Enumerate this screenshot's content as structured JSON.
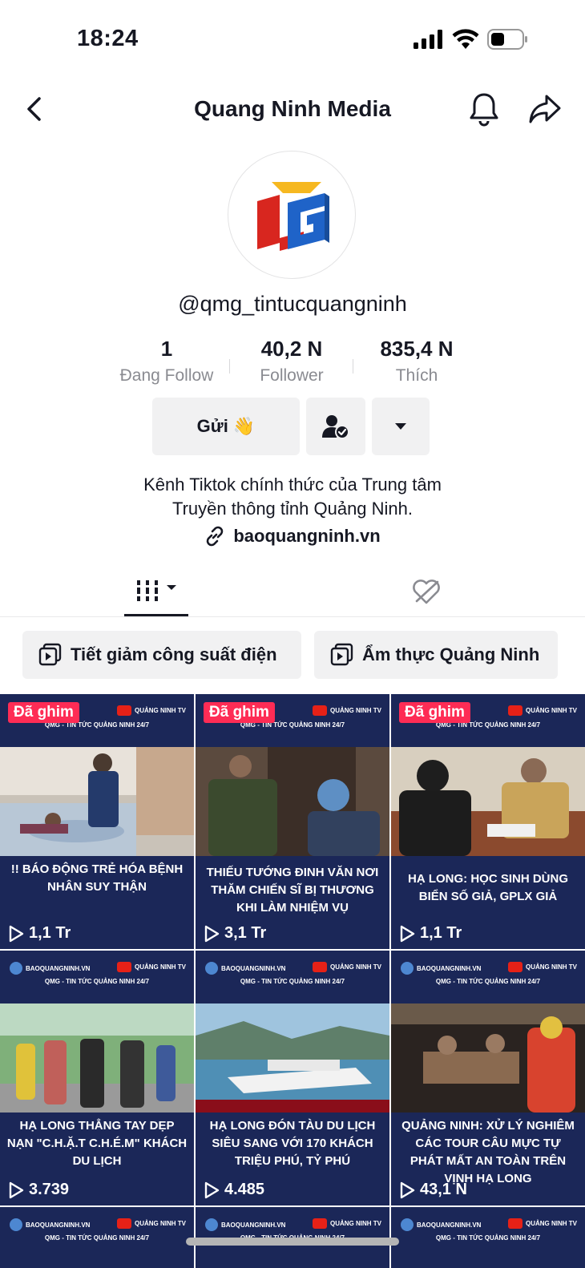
{
  "status": {
    "time": "18:24"
  },
  "nav": {
    "title": "Quang Ninh Media"
  },
  "profile": {
    "username": "@qmg_tintucquangninh",
    "stats": [
      {
        "value": "1",
        "label": "Đang Follow"
      },
      {
        "value": "40,2 N",
        "label": "Follower"
      },
      {
        "value": "835,4 N",
        "label": "Thích"
      }
    ],
    "send_label": "Gửi 👋",
    "bio": "Kênh Tiktok chính thức của Trung tâm Truyền thông tỉnh Quảng Ninh.",
    "link": "baoquangninh.vn"
  },
  "playlists": [
    {
      "label": "Tiết giảm công suất điện"
    },
    {
      "label": "Ẩm thực Quảng Ninh"
    }
  ],
  "videos": [
    {
      "pinned": "Đã ghim",
      "caption": "!! BÁO ĐỘNG TRẺ HÓA BỆNH NHÂN SUY THẬN",
      "views": "1,1 Tr"
    },
    {
      "pinned": "Đã ghim",
      "caption": "THIẾU TƯỚNG ĐINH VĂN NƠI THĂM CHIẾN SĨ BỊ THƯƠNG KHI LÀM NHIỆM VỤ",
      "views": "3,1 Tr"
    },
    {
      "pinned": "Đã ghim",
      "caption": "HẠ LONG: HỌC SINH DÙNG BIỂN SỐ GIẢ, GPLX GIẢ",
      "views": "1,1 Tr"
    },
    {
      "pinned": "",
      "caption": "HẠ LONG THẲNG TAY DẸP NẠN \"C.H.Ặ.T C.H.É.M\" KHÁCH DU LỊCH",
      "views": "3.739"
    },
    {
      "pinned": "",
      "caption": "HẠ LONG ĐÓN TÀU DU LỊCH SIÊU SANG VỚI 170 KHÁCH TRIỆU PHÚ, TỶ PHÚ",
      "views": "4.485"
    },
    {
      "pinned": "",
      "caption": "QUẢNG NINH: XỬ LÝ NGHIÊM CÁC TOUR CÂU MỰC TỰ PHÁT MẤT AN TOÀN TRÊN VỊNH HẠ LONG",
      "views": "43,1 N"
    }
  ],
  "tile_branding": {
    "site": "BAOQUANGNINH.VN",
    "tv": "QUẢNG NINH TV",
    "fb": "QMG - TIN TỨC QUẢNG NINH 24/7"
  },
  "colors": {
    "accent": "#fe2c55",
    "tile_bg": "#1b2758"
  },
  "icons": [
    "back-icon",
    "bell-icon",
    "share-icon",
    "add-friend-icon",
    "dropdown-icon",
    "link-icon",
    "grid-icon",
    "liked-hidden-icon",
    "playlist-icon",
    "play-icon"
  ]
}
